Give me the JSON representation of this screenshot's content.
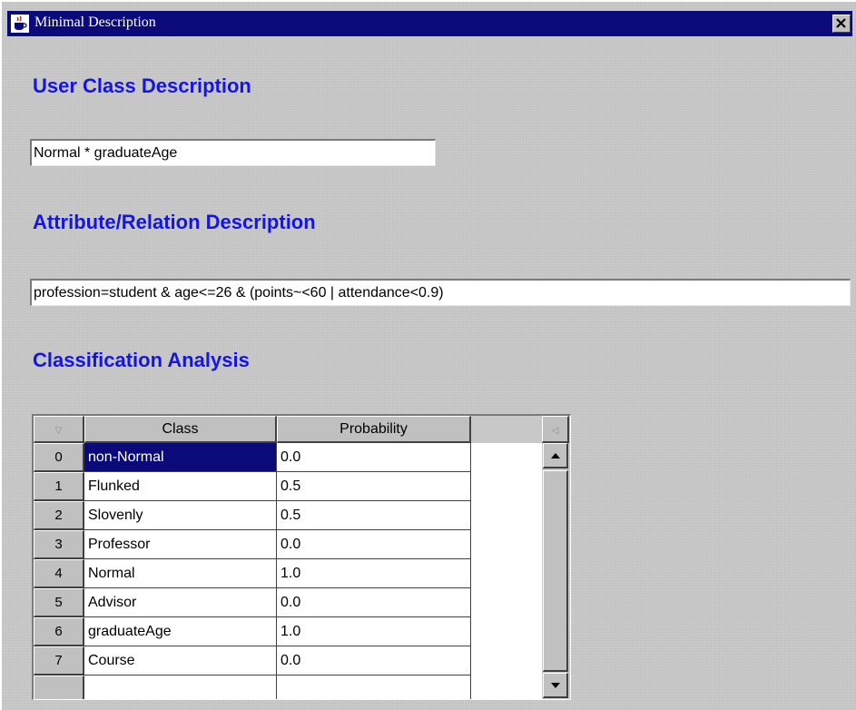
{
  "window": {
    "title": "Minimal Description",
    "icon": "java-cup-icon",
    "close_icon": "close-x-icon"
  },
  "sections": {
    "user_class": {
      "heading": "User Class Description",
      "value": "Normal * graduateAge"
    },
    "attribute_relation": {
      "heading": "Attribute/Relation Description",
      "value": "profession=student & age<=26 & (points~<60 | attendance<0.9)"
    },
    "classification": {
      "heading": "Classification Analysis"
    }
  },
  "table": {
    "columns": [
      "Class",
      "Probability"
    ],
    "corner_icon": "sort-triangle-icon",
    "selected_row": 0,
    "rows": [
      {
        "index": "0",
        "class": "non-Normal",
        "probability": "0.0"
      },
      {
        "index": "1",
        "class": "Flunked",
        "probability": "0.5"
      },
      {
        "index": "2",
        "class": "Slovenly",
        "probability": "0.5"
      },
      {
        "index": "3",
        "class": "Professor",
        "probability": "0.0"
      },
      {
        "index": "4",
        "class": "Normal",
        "probability": "1.0"
      },
      {
        "index": "5",
        "class": "Advisor",
        "probability": "0.0"
      },
      {
        "index": "6",
        "class": "graduateAge",
        "probability": "1.0"
      },
      {
        "index": "7",
        "class": "Course",
        "probability": "0.0"
      }
    ]
  },
  "colors": {
    "titlebar": "#0a0a7a",
    "heading": "#1414e6",
    "selection": "#0a0a7a"
  }
}
